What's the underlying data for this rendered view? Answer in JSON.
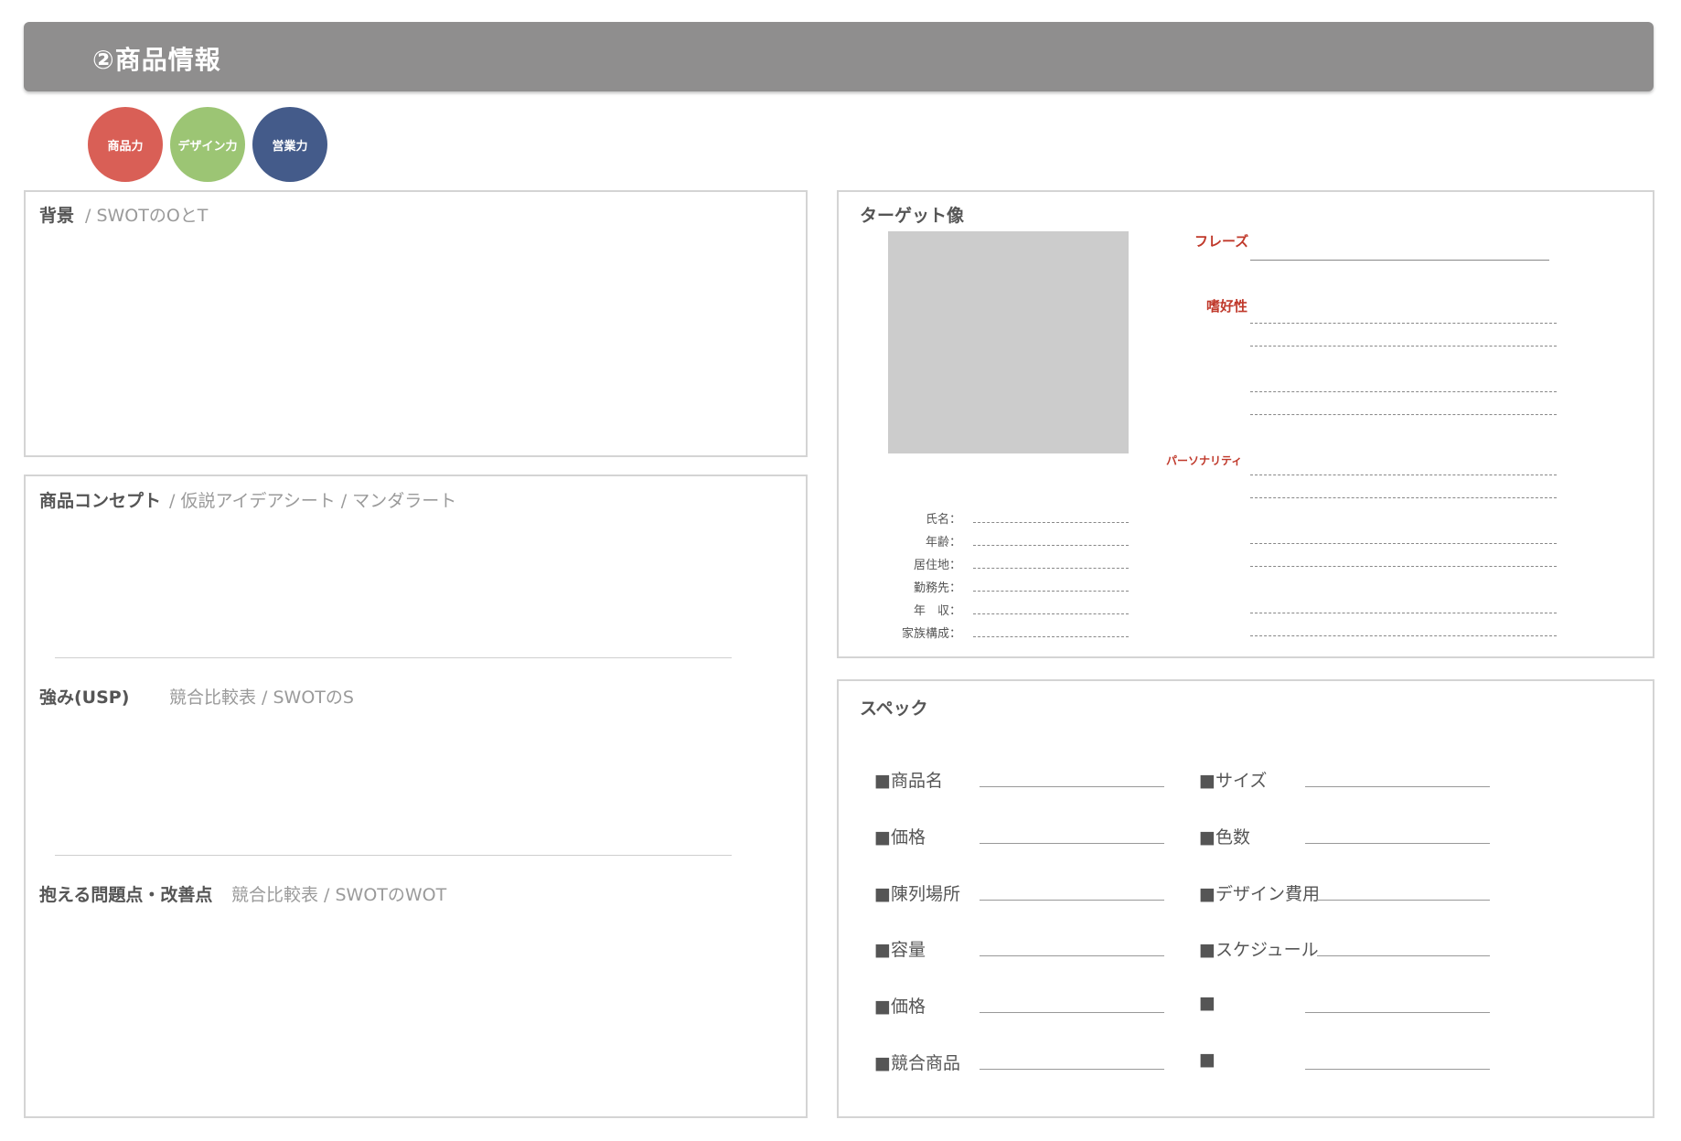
{
  "header": {
    "title": "②商品情報"
  },
  "tags": [
    {
      "label": "商品力",
      "color": "#d95f56"
    },
    {
      "label": "デザイン力",
      "color": "#9cc574"
    },
    {
      "label": "営業力",
      "color": "#445b8a"
    }
  ],
  "background": {
    "title": "背景",
    "sub": "/ SWOTのOとT"
  },
  "concept": {
    "title": "商品コンセプト",
    "sub": "/ 仮説アイデアシート / マンダラート",
    "strength_title": "強み(USP)",
    "strength_sub": "競合比較表 / SWOTのS",
    "problem_title": "抱える問題点・改善点",
    "problem_sub": "競合比較表 / SWOTのWOT"
  },
  "target": {
    "title": "ターゲット像",
    "phrase_label": "フレーズ",
    "preference_label": "嗜好性",
    "personality_label": "パーソナリティ",
    "fields": [
      "氏名：",
      "年齢：",
      "居住地：",
      "勤務先：",
      "年　収：",
      "家族構成："
    ]
  },
  "spec": {
    "title": "スペック",
    "left": [
      "■商品名",
      "■価格",
      "■陳列場所",
      "■容量",
      "■価格",
      "■競合商品"
    ],
    "right": [
      "■サイズ",
      "■色数",
      "■デザイン費用",
      "■スケジュール",
      "■",
      "■"
    ]
  }
}
